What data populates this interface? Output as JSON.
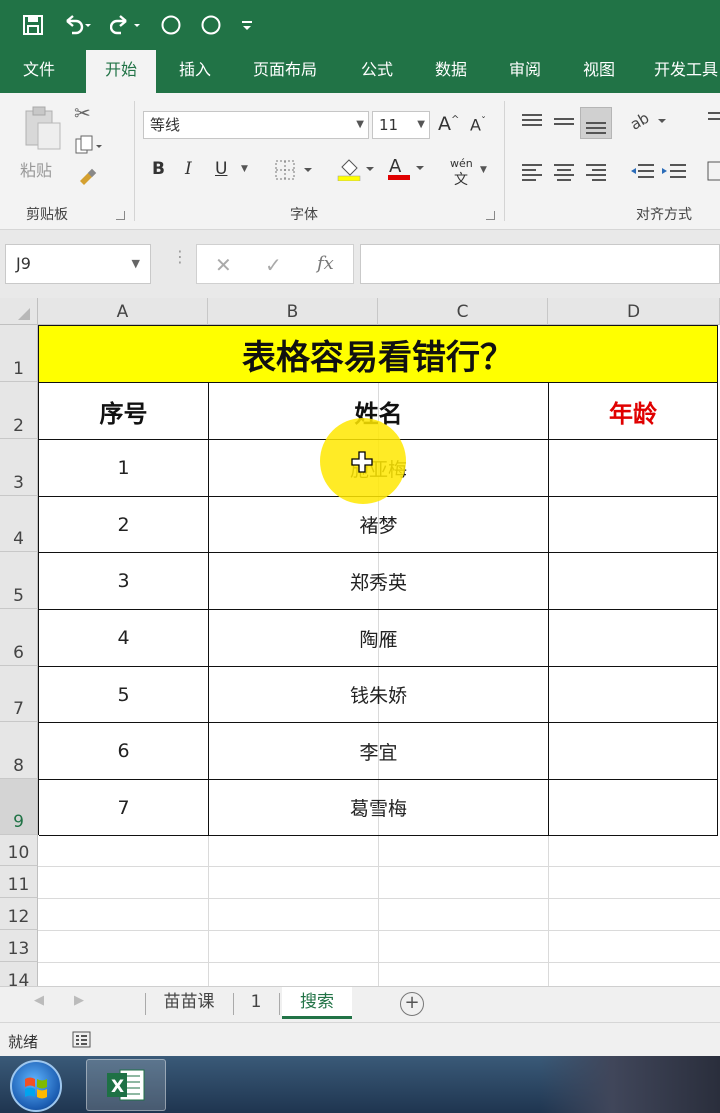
{
  "quick_access": {
    "icons": [
      "save-icon",
      "undo-icon",
      "redo-icon",
      "circle-icon",
      "circle-icon",
      "customize-icon"
    ]
  },
  "tabs": [
    "文件",
    "开始",
    "插入",
    "页面布局",
    "公式",
    "数据",
    "审阅",
    "视图",
    "开发工具"
  ],
  "active_tab": "开始",
  "ribbon": {
    "clipboard": {
      "paste_label": "粘贴",
      "group_label": "剪贴板"
    },
    "font": {
      "font_name": "等线",
      "font_size": "11",
      "bold": "B",
      "italic": "I",
      "underline": "U",
      "phonetic_top": "wén",
      "phonetic_bottom": "文",
      "group_label": "字体",
      "fill_color": "#ffff00",
      "font_color": "#ff0000"
    },
    "alignment": {
      "group_label": "对齐方式"
    }
  },
  "formula_bar": {
    "cell_ref": "J9",
    "fx": "fx",
    "value": ""
  },
  "columns": [
    "A",
    "B",
    "C",
    "D"
  ],
  "rows": [
    "1",
    "2",
    "3",
    "4",
    "5",
    "6",
    "7",
    "8",
    "9",
    "10",
    "11",
    "12",
    "13",
    "14"
  ],
  "sheet": {
    "title": "表格容易看错行？",
    "headers": {
      "seq": "序号",
      "name": "姓名",
      "age": "年龄"
    },
    "age_header_color": "#e00000",
    "records": [
      {
        "seq": "1",
        "name": "施亚梅"
      },
      {
        "seq": "2",
        "name": "褚梦"
      },
      {
        "seq": "3",
        "name": "郑秀英"
      },
      {
        "seq": "4",
        "name": "陶雁"
      },
      {
        "seq": "5",
        "name": "钱朱娇"
      },
      {
        "seq": "6",
        "name": "李宜"
      },
      {
        "seq": "7",
        "name": "葛雪梅"
      }
    ]
  },
  "sheet_tabs": [
    "苗苗课",
    "1",
    "搜索"
  ],
  "active_sheet": "搜索",
  "status": {
    "ready": "就绪"
  },
  "accent_color": "#217346"
}
